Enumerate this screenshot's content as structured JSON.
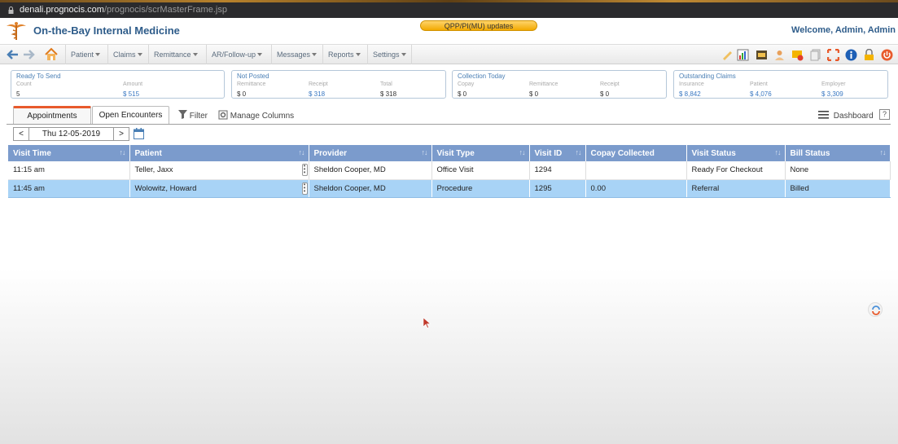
{
  "browser": {
    "domain": "denali.prognocis.com",
    "path": "/prognocis/scrMasterFrame.jsp"
  },
  "header": {
    "clinic_name": "On-the-Bay Internal Medicine",
    "update_banner": "QPP/PI(MU) updates",
    "welcome": "Welcome, Admin, Admin"
  },
  "menu": [
    "Patient",
    "Claims",
    "Remittance",
    "AR/Follow-up",
    "Messages",
    "Reports",
    "Settings"
  ],
  "summary": {
    "ready_to_send": {
      "title": "Ready To Send",
      "count_label": "Count",
      "count": "5",
      "amount_label": "Amount",
      "amount": "$ 515"
    },
    "not_posted": {
      "title": "Not Posted",
      "remittance_label": "Remittance",
      "remittance": "$ 0",
      "receipt_label": "Receipt",
      "receipt": "$ 318",
      "total_label": "Total",
      "total": "$ 318"
    },
    "collection_today": {
      "title": "Collection Today",
      "copay_label": "Copay",
      "copay": "$ 0",
      "remittance_label": "Remittance",
      "remittance": "$ 0",
      "receipt_label": "Receipt",
      "receipt": "$ 0"
    },
    "outstanding_claims": {
      "title": "Outstanding Claims",
      "insurance_label": "Insurance",
      "insurance": "$ 8,842",
      "patient_label": "Patient",
      "patient": "$ 4,076",
      "employer_label": "Employer",
      "employer": "$ 3,309"
    }
  },
  "tabs": {
    "appointments": "Appointments",
    "open_encounters": "Open Encounters"
  },
  "toolbar": {
    "filter": "Filter",
    "manage_columns": "Manage Columns",
    "dashboard": "Dashboard",
    "help": "?"
  },
  "date_nav": {
    "prev": "<",
    "date": "Thu 12-05-2019",
    "next": ">"
  },
  "table": {
    "columns": [
      "Visit Time",
      "Patient",
      "Provider",
      "Visit Type",
      "Visit ID",
      "Copay Collected",
      "Visit Status",
      "Bill Status"
    ],
    "rows": [
      [
        "11:15 am",
        "Teller, Jaxx",
        "Sheldon Cooper, MD",
        "Office Visit",
        "1294",
        "",
        "Ready For Checkout",
        "None"
      ],
      [
        "11:45 am",
        "Wolowitz, Howard",
        "Sheldon Cooper, MD",
        "Procedure",
        "1295",
        "0.00",
        "Referral",
        "Billed"
      ]
    ]
  },
  "colors": {
    "header_blue": "#2e5c8a",
    "grid_header": "#7b9bcc",
    "selected_row": "#a8d3f6",
    "tab_accent": "#e85a2c"
  }
}
